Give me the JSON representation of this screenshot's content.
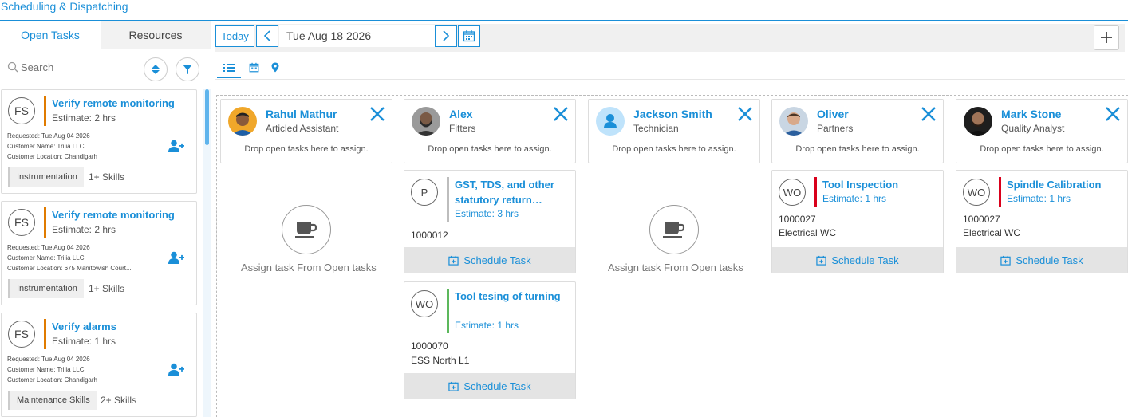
{
  "app": {
    "title": "Scheduling & Dispatching"
  },
  "left": {
    "tabs": [
      {
        "label": "Open Tasks",
        "active": true
      },
      {
        "label": "Resources",
        "active": false
      }
    ],
    "search": {
      "placeholder": "Search"
    },
    "tasks": [
      {
        "badge": "FS",
        "title": "Verify remote monitoring",
        "estimate": "Estimate: 2 hrs",
        "requested": "Requested: Tue Aug 04 2026",
        "customer": "Customer Name: Trilia LLC",
        "location": "Customer Location: Chandigarh",
        "skill": "Instrumentation",
        "skills_count": "1+ Skills"
      },
      {
        "badge": "FS",
        "title": "Verify remote monitoring",
        "estimate": "Estimate: 2 hrs",
        "requested": "Requested: Tue Aug 04 2026",
        "customer": "Customer Name: Trilia LLC",
        "location": "Customer Location: 675 Manitowish Court...",
        "skill": "Instrumentation",
        "skills_count": "1+ Skills"
      },
      {
        "badge": "FS",
        "title": "Verify alarms",
        "estimate": "Estimate: 1 hrs",
        "requested": "Requested: Tue Aug 04 2026",
        "customer": "Customer Name: Trilia LLC",
        "location": "Customer Location: Chandigarh",
        "skill": "Maintenance Skills",
        "skills_count": "2+ Skills"
      }
    ]
  },
  "toolbar": {
    "today": "Today",
    "date": "Tue Aug 18 2026"
  },
  "resources": [
    {
      "name": "Rahul Mathur",
      "role": "Articled Assistant",
      "drop_hint": "Drop open tasks here to assign."
    },
    {
      "name": "Alex",
      "role": "Fitters",
      "drop_hint": "Drop open tasks here to assign."
    },
    {
      "name": "Jackson Smith",
      "role": "Technician",
      "drop_hint": "Drop open tasks here to assign."
    },
    {
      "name": "Oliver",
      "role": "Partners",
      "drop_hint": "Drop open tasks here to assign."
    },
    {
      "name": "Mark Stone",
      "role": "Quality Analyst",
      "drop_hint": "Drop open tasks here to assign."
    }
  ],
  "empty": {
    "text": "Assign task From Open tasks"
  },
  "assigned": {
    "alex_1": {
      "badge": "P",
      "title": "GST, TDS, and other statutory return…",
      "estimate": "Estimate: 3 hrs",
      "line1": "1000012",
      "action": "Schedule Task"
    },
    "alex_2": {
      "badge": "WO",
      "title": "Tool tesing of turning",
      "estimate": "Estimate: 1 hrs",
      "line1": "1000070",
      "line2": "ESS North L1",
      "action": "Schedule Task"
    },
    "oliver_1": {
      "badge": "WO",
      "title": "Tool Inspection",
      "estimate": "Estimate: 1 hrs",
      "line1": "1000027",
      "line2": "Electrical WC",
      "action": "Schedule Task"
    },
    "mark_1": {
      "badge": "WO",
      "title": "Spindle Calibration",
      "estimate": "Estimate: 1 hrs",
      "line1": "1000027",
      "line2": "Electrical WC",
      "action": "Schedule Task"
    }
  },
  "colors": {
    "accent": "#1a8fd8",
    "task_bar": "#e07b00",
    "priority_red": "#d9001b",
    "priority_green": "#5cb85c",
    "priority_gray": "#bdbdbd"
  }
}
